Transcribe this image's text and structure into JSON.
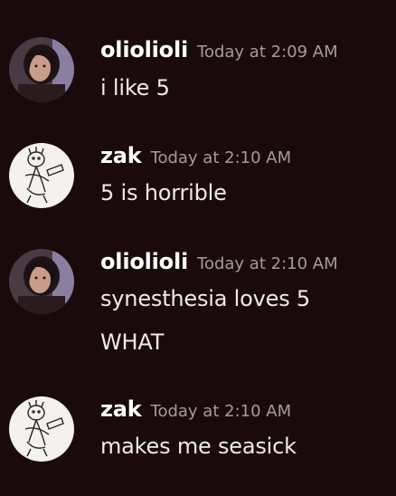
{
  "colors": {
    "background": "#1a0a0c",
    "author": "#ffffff",
    "timestamp": "#a39c9c",
    "message": "#eeeae9"
  },
  "messages": [
    {
      "author": "oliolioli",
      "timestamp": "Today at 2:09 AM",
      "avatar_icon": "photo-avatar",
      "lines": [
        "i like 5"
      ]
    },
    {
      "author": "zak",
      "timestamp": "Today at 2:10 AM",
      "avatar_icon": "sketch-avatar",
      "lines": [
        "5 is horrible"
      ]
    },
    {
      "author": "oliolioli",
      "timestamp": "Today at 2:10 AM",
      "avatar_icon": "photo-avatar",
      "lines": [
        "synesthesia loves 5",
        "WHAT"
      ]
    },
    {
      "author": "zak",
      "timestamp": "Today at 2:10 AM",
      "avatar_icon": "sketch-avatar",
      "lines": [
        "makes me seasick"
      ]
    }
  ]
}
